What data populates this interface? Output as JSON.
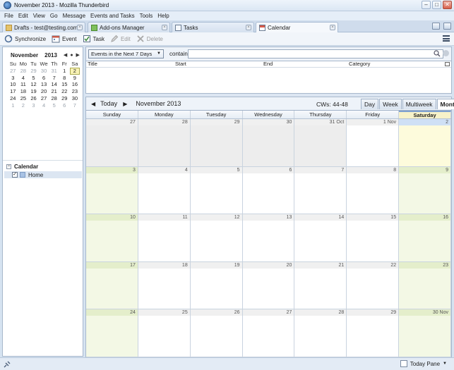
{
  "window": {
    "title": "November 2013 - Mozilla Thunderbird"
  },
  "menu": [
    "File",
    "Edit",
    "View",
    "Go",
    "Message",
    "Events and Tasks",
    "Tools",
    "Help"
  ],
  "tabs": [
    {
      "label": "Drafts - test@testing.com"
    },
    {
      "label": "Add-ons Manager"
    },
    {
      "label": "Tasks"
    },
    {
      "label": "Calendar"
    }
  ],
  "toolbar": {
    "synchronize": "Synchronize",
    "event": "Event",
    "task": "Task",
    "edit": "Edit",
    "delete": "Delete"
  },
  "minimonth": {
    "month": "November",
    "year": "2013",
    "weekdays": [
      "Su",
      "Mo",
      "Tu",
      "We",
      "Th",
      "Fr",
      "Sa"
    ],
    "weeks": [
      [
        "27",
        "28",
        "29",
        "30",
        "31",
        "1",
        "2"
      ],
      [
        "3",
        "4",
        "5",
        "6",
        "7",
        "8",
        "9"
      ],
      [
        "10",
        "11",
        "12",
        "13",
        "14",
        "15",
        "16"
      ],
      [
        "17",
        "18",
        "19",
        "20",
        "21",
        "22",
        "23"
      ],
      [
        "24",
        "25",
        "26",
        "27",
        "28",
        "29",
        "30"
      ],
      [
        "1",
        "2",
        "3",
        "4",
        "5",
        "6",
        "7"
      ]
    ],
    "today": "2"
  },
  "calendar_list": {
    "heading": "Calendar",
    "items": [
      {
        "name": "Home",
        "checked": true,
        "color": "#a8c2e4"
      }
    ]
  },
  "event_filter": {
    "selected": "Events in the Next 7 Days",
    "contain_label": "contain",
    "search_value": ""
  },
  "event_list": {
    "columns": [
      "Title",
      "Start",
      "End",
      "Category"
    ]
  },
  "month_view": {
    "today_label": "Today",
    "month_label": "November 2013",
    "cw_label": "CWs: 44-48",
    "views": [
      "Day",
      "Week",
      "Multiweek",
      "Month"
    ],
    "active_view": "Month",
    "day_headers": [
      "Sunday",
      "Monday",
      "Tuesday",
      "Wednesday",
      "Thursday",
      "Friday",
      "Saturday"
    ],
    "selected_day": "Saturday",
    "weeks": [
      [
        "27",
        "28",
        "29",
        "30",
        "31 Oct",
        "1 Nov",
        "2"
      ],
      [
        "3",
        "4",
        "5",
        "6",
        "7",
        "8",
        "9"
      ],
      [
        "10",
        "11",
        "12",
        "13",
        "14",
        "15",
        "16"
      ],
      [
        "17",
        "18",
        "19",
        "20",
        "21",
        "22",
        "23"
      ],
      [
        "24",
        "25",
        "26",
        "27",
        "28",
        "29",
        "30 Nov"
      ]
    ]
  },
  "statusbar": {
    "today_pane": "Today Pane"
  },
  "colors": {
    "weekend": "#f3f8e5",
    "selected": "#fdfbdc",
    "outside": "#ededed"
  }
}
